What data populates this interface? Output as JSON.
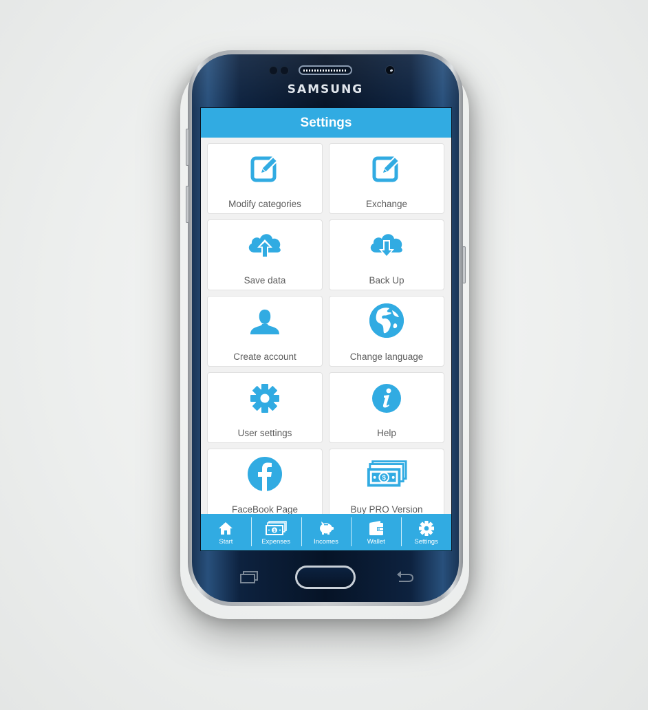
{
  "device": {
    "brand": "SAMSUNG"
  },
  "header": {
    "title": "Settings"
  },
  "colors": {
    "accent": "#31abe2",
    "card_background": "#ffffff",
    "screen_background": "#f1f1f1",
    "label_text": "#5b5b5b"
  },
  "tiles": [
    {
      "label": "Modify categories",
      "icon": "edit-icon"
    },
    {
      "label": "Exchange",
      "icon": "edit-icon"
    },
    {
      "label": "Save data",
      "icon": "cloud-upload-icon"
    },
    {
      "label": "Back Up",
      "icon": "cloud-download-icon"
    },
    {
      "label": "Create account",
      "icon": "user-icon"
    },
    {
      "label": "Change language",
      "icon": "globe-icon"
    },
    {
      "label": "User settings",
      "icon": "gear-icon"
    },
    {
      "label": "Help",
      "icon": "info-icon"
    },
    {
      "label": "FaceBook Page",
      "icon": "facebook-icon"
    },
    {
      "label": "Buy PRO Version",
      "icon": "money-icon"
    }
  ],
  "bottom_nav": [
    {
      "label": "Start",
      "icon": "home-icon"
    },
    {
      "label": "Expenses",
      "icon": "money-icon"
    },
    {
      "label": "Incomes",
      "icon": "piggy-bank-icon"
    },
    {
      "label": "Wallet",
      "icon": "wallet-icon"
    },
    {
      "label": "Settings",
      "icon": "gear-icon",
      "active": true
    }
  ]
}
